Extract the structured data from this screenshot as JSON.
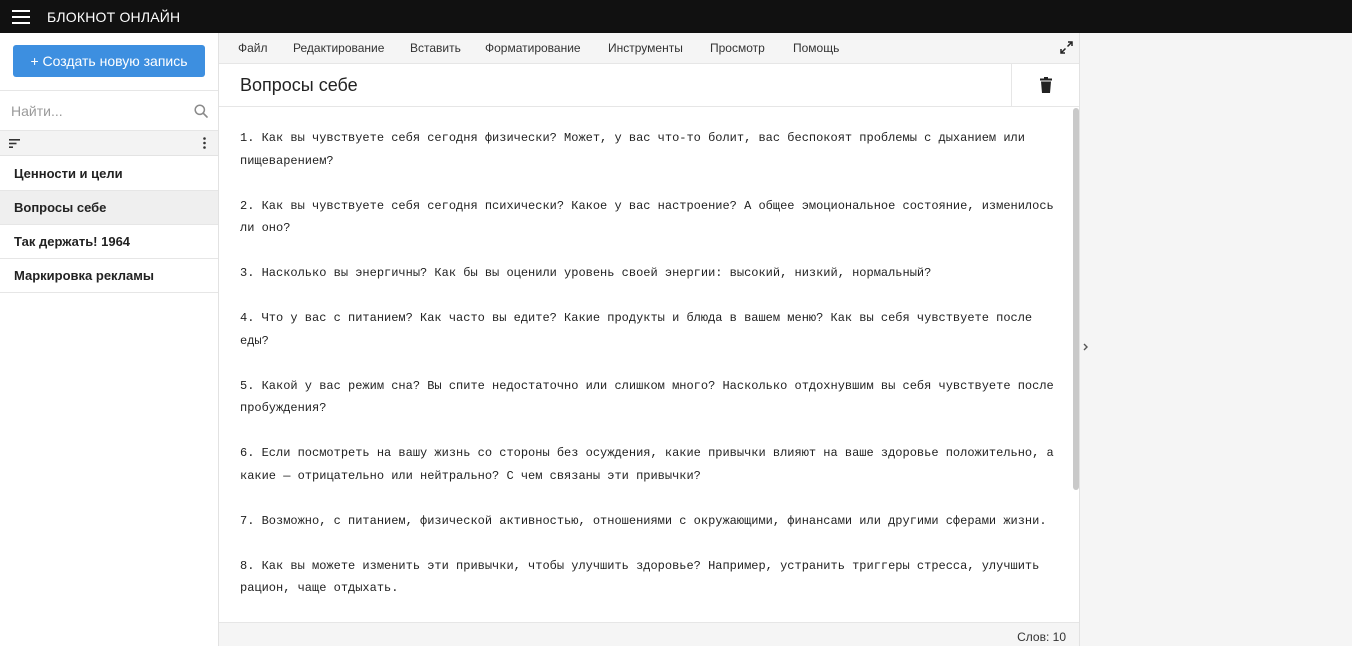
{
  "header": {
    "title": "БЛОКНОТ ОНЛАЙН"
  },
  "sidebar": {
    "create_label": "+ Создать новую запись",
    "search_placeholder": "Найти...",
    "notes": [
      {
        "label": "Ценности и цели"
      },
      {
        "label": "Вопросы себе",
        "active": true
      },
      {
        "label": "Так держать! 1964"
      },
      {
        "label": "Маркировка рекламы"
      }
    ]
  },
  "menu": [
    "Файл",
    "Редактирование",
    "Вставить",
    "Форматирование",
    "Инструменты",
    "Просмотр",
    "Помощь"
  ],
  "note": {
    "title": "Вопросы себе",
    "paragraphs": [
      "1. Как вы чувствуете себя сегодня физически? Может, у вас что-то болит, вас беспокоят проблемы с дыханием или пищеварением?",
      "2. Как вы чувствуете себя сегодня психически? Какое у вас настроение? А общее эмоциональное состояние, изменилось ли оно?",
      "3. Насколько вы энергичны? Как бы вы оценили уровень своей энергии: высокий, низкий, нормальный?",
      "4. Что у вас с питанием? Как часто вы едите? Какие продукты и блюда в вашем меню? Как вы себя чувствуете после еды?",
      "5. Какой у вас режим сна? Вы спите недостаточно или слишком много? Насколько отдохнувшим вы себя чувствуете после пробуждения?",
      "6. Если посмотреть на вашу жизнь со стороны без осуждения, какие привычки влияют на ваше здоровье положительно, а какие — отрицательно или нейтрально? С чем связаны эти привычки?",
      "7. Возможно, с питанием, физической активностью, отношениями с окружающими, финансами или другими сферами жизни.",
      "8. Как вы можете изменить эти привычки, чтобы улучшить здоровье? Например, устранить триггеры стресса, улучшить рацион, чаще отдыхать."
    ]
  },
  "status": {
    "word_count": "Слов: 10"
  },
  "colors": {
    "topbar": "#111111",
    "accent": "#3d8fe0",
    "active_row": "#efefef"
  }
}
